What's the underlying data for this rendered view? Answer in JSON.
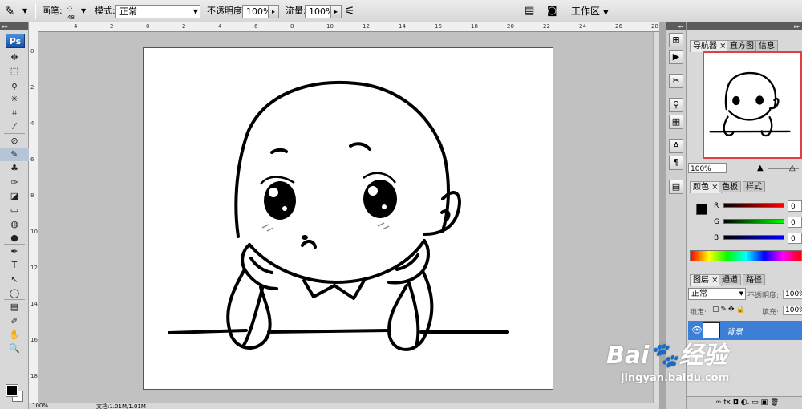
{
  "options": {
    "brush_label": "画笔:",
    "brush_size": "48",
    "mode_label": "模式:",
    "mode_value": "正常",
    "opacity_label": "不透明度:",
    "opacity_value": "100%",
    "flow_label": "流量:",
    "flow_value": "100%",
    "workspace_label": "工作区",
    "workspace_arrow": "▼"
  },
  "rulers": {
    "top": [
      "4",
      "2",
      "0",
      "2",
      "4",
      "6",
      "8",
      "10",
      "12",
      "14",
      "16",
      "18",
      "20",
      "22",
      "24",
      "26",
      "28"
    ],
    "left": [
      "0",
      "2",
      "4",
      "6",
      "8",
      "10",
      "12",
      "14",
      "16",
      "18"
    ]
  },
  "tools": {
    "logo": "Ps",
    "icons": [
      "move-icon",
      "marquee-icon",
      "lasso-icon",
      "magic-wand-icon",
      "crop-icon",
      "slice-icon",
      "healing-brush-icon",
      "brush-icon",
      "clone-stamp-icon",
      "history-brush-icon",
      "eraser-icon",
      "gradient-icon",
      "blur-icon",
      "dodge-icon",
      "pen-icon",
      "type-icon",
      "path-selection-icon",
      "shape-icon",
      "notes-icon",
      "eyedropper-icon",
      "hand-icon",
      "zoom-icon"
    ],
    "glyphs": [
      "✥",
      "⬚",
      "ϙ",
      "✳",
      "⌗",
      "⁄",
      "⊘",
      "✎",
      "♣",
      "✑",
      "◪",
      "▭",
      "◍",
      "●",
      "✒",
      "T",
      "↖",
      "◯",
      "▤",
      "✐",
      "✋",
      "🔍"
    ],
    "fg_color": "#000000",
    "bg_color": "#ffffff"
  },
  "status": {
    "zoom": "100%",
    "doc_info": "文档:1.01M/1.01M"
  },
  "navigator": {
    "tabs": [
      "导航器",
      "直方图",
      "信息"
    ],
    "zoom_value": "100%"
  },
  "color_panel": {
    "tabs": [
      "颜色",
      "色板",
      "样式"
    ],
    "channels": [
      {
        "label": "R",
        "value": "0",
        "gradient": "linear-gradient(90deg,#000,#f00)"
      },
      {
        "label": "G",
        "value": "0",
        "gradient": "linear-gradient(90deg,#000,#0f0)"
      },
      {
        "label": "B",
        "value": "0",
        "gradient": "linear-gradient(90deg,#000,#00f)"
      }
    ]
  },
  "layers_panel": {
    "tabs": [
      "图层",
      "通道",
      "路径"
    ],
    "blend_mode": "正常",
    "opacity_label": "不透明度:",
    "opacity_value": "100%",
    "lock_label": "锁定:",
    "fill_label": "填充:",
    "fill_value": "100%",
    "layer_name": "背景",
    "bottom_icons": "∞ fx ◘ ◐. ▭ ▣ 🗑"
  },
  "watermark": {
    "logo": "Bai🐾经验",
    "url": "jingyan.baidu.com"
  }
}
